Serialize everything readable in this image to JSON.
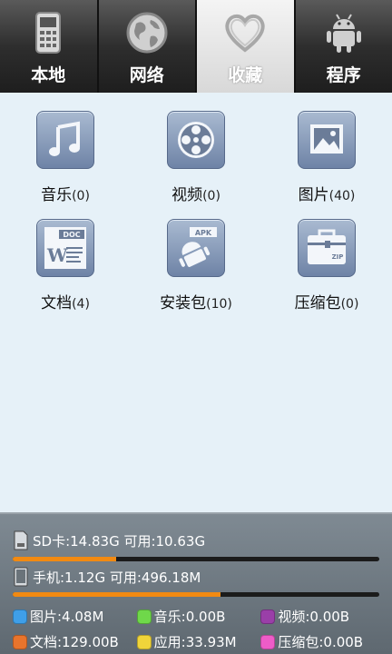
{
  "tabs": [
    {
      "label": "本地",
      "icon": "phone-icon",
      "active": false
    },
    {
      "label": "网络",
      "icon": "globe-icon",
      "active": false
    },
    {
      "label": "收藏",
      "icon": "heart-icon",
      "active": true
    },
    {
      "label": "程序",
      "icon": "android-icon",
      "active": false
    }
  ],
  "categories": [
    {
      "name": "音乐",
      "count": "(0)",
      "icon": "music-icon"
    },
    {
      "name": "视频",
      "count": "(0)",
      "icon": "film-reel-icon"
    },
    {
      "name": "图片",
      "count": "(40)",
      "icon": "picture-icon"
    },
    {
      "name": "文档",
      "count": "(4)",
      "icon": "document-icon"
    },
    {
      "name": "安装包",
      "count": "(10)",
      "icon": "apk-package-icon"
    },
    {
      "name": "压缩包",
      "count": "(0)",
      "icon": "zip-archive-icon"
    }
  ],
  "storage": {
    "sd": {
      "label": "SD卡:14.83G  可用:10.63G",
      "used_fraction": 0.283
    },
    "phone": {
      "label": "手机:1.12G  可用:496.18M",
      "used_fraction": 0.567
    },
    "legend": [
      {
        "label": "图片:4.08M",
        "color": "#3f9fe8"
      },
      {
        "label": "音乐:0.00B",
        "color": "#6fd84a"
      },
      {
        "label": "视频:0.00B",
        "color": "#9a3fa8"
      },
      {
        "label": "文档:129.00B",
        "color": "#e8742c"
      },
      {
        "label": "应用:33.93M",
        "color": "#f0d43a"
      },
      {
        "label": "压缩包:0.00B",
        "color": "#ee5cc8"
      }
    ]
  }
}
